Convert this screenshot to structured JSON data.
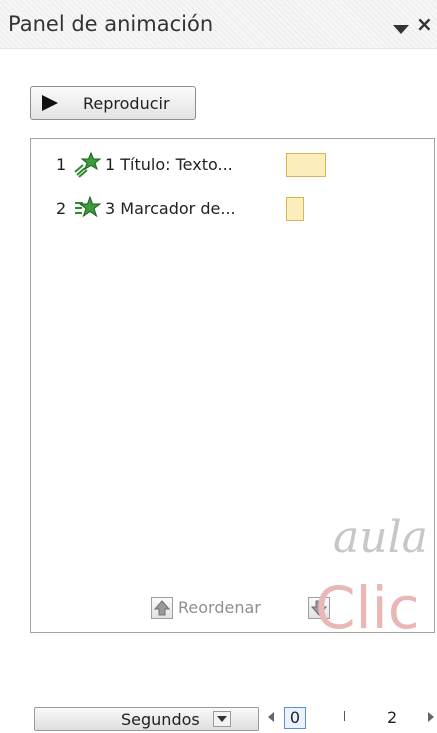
{
  "panel": {
    "title": "Panel de animación",
    "title_arrow_icon": "chevron-down-icon",
    "close_label": "×"
  },
  "toolbar": {
    "play_label": "Reproducir",
    "play_icon": "play-icon"
  },
  "animations": [
    {
      "number": "1",
      "icon": "fly-in-star-icon",
      "label": "1 Título: Texto..."
    },
    {
      "number": "2",
      "icon": "appear-star-icon",
      "label": "3 Marcador de..."
    }
  ],
  "timeline": {
    "seconds_label": "Segundos",
    "start_value": "0",
    "mark_value": "2"
  },
  "reorder": {
    "label": "Reordenar"
  },
  "watermark": {
    "text_line1": "aula",
    "text_line2": "Clic"
  },
  "colors": {
    "timing_bar_fill": "#fbeebb",
    "timing_bar_border": "#d6b656",
    "star_green": "#2d8a2d"
  }
}
